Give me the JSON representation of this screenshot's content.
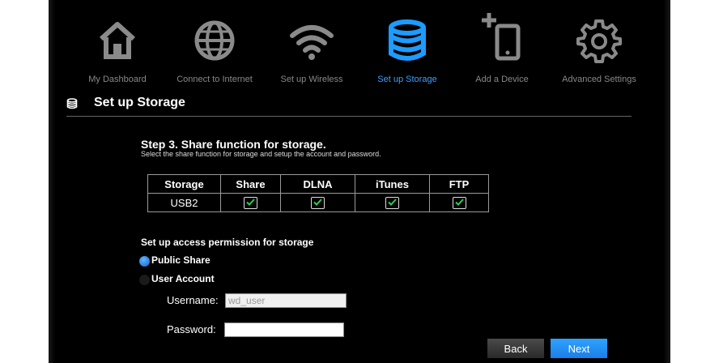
{
  "nav": {
    "items": [
      {
        "label": "My Dashboard",
        "icon": "home-icon",
        "active": false
      },
      {
        "label": "Connect to Internet",
        "icon": "globe-icon",
        "active": false
      },
      {
        "label": "Set up Wireless",
        "icon": "wifi-icon",
        "active": false
      },
      {
        "label": "Set up Storage",
        "icon": "storage-icon",
        "active": true
      },
      {
        "label": "Add a Device",
        "icon": "add-device-icon",
        "active": false
      },
      {
        "label": "Advanced Settings",
        "icon": "gear-icon",
        "active": false
      }
    ]
  },
  "page": {
    "title": "Set up Storage",
    "title_icon": "storage-icon"
  },
  "step": {
    "title": "Step 3. Share function for storage.",
    "subtitle": "Select the share function for storage and setup the account and password."
  },
  "table": {
    "headers": [
      "Storage",
      "Share",
      "DLNA",
      "iTunes",
      "FTP"
    ],
    "rows": [
      {
        "storage": "USB2",
        "share": true,
        "dlna": true,
        "itunes": true,
        "ftp": true
      }
    ]
  },
  "permission": {
    "title": "Set up access permission for storage",
    "options": [
      {
        "label": "Public Share",
        "selected": true
      },
      {
        "label": "User Account",
        "selected": false
      }
    ]
  },
  "account": {
    "username_label": "Username:",
    "username_value": "wd_user",
    "password_label": "Password:",
    "password_value": ""
  },
  "buttons": {
    "back": "Back",
    "next": "Next"
  },
  "colors": {
    "accent": "#3aa0ff",
    "nav_icon": "#8a8a8a",
    "next_button": "#1b8cf0",
    "background": "#000000"
  }
}
